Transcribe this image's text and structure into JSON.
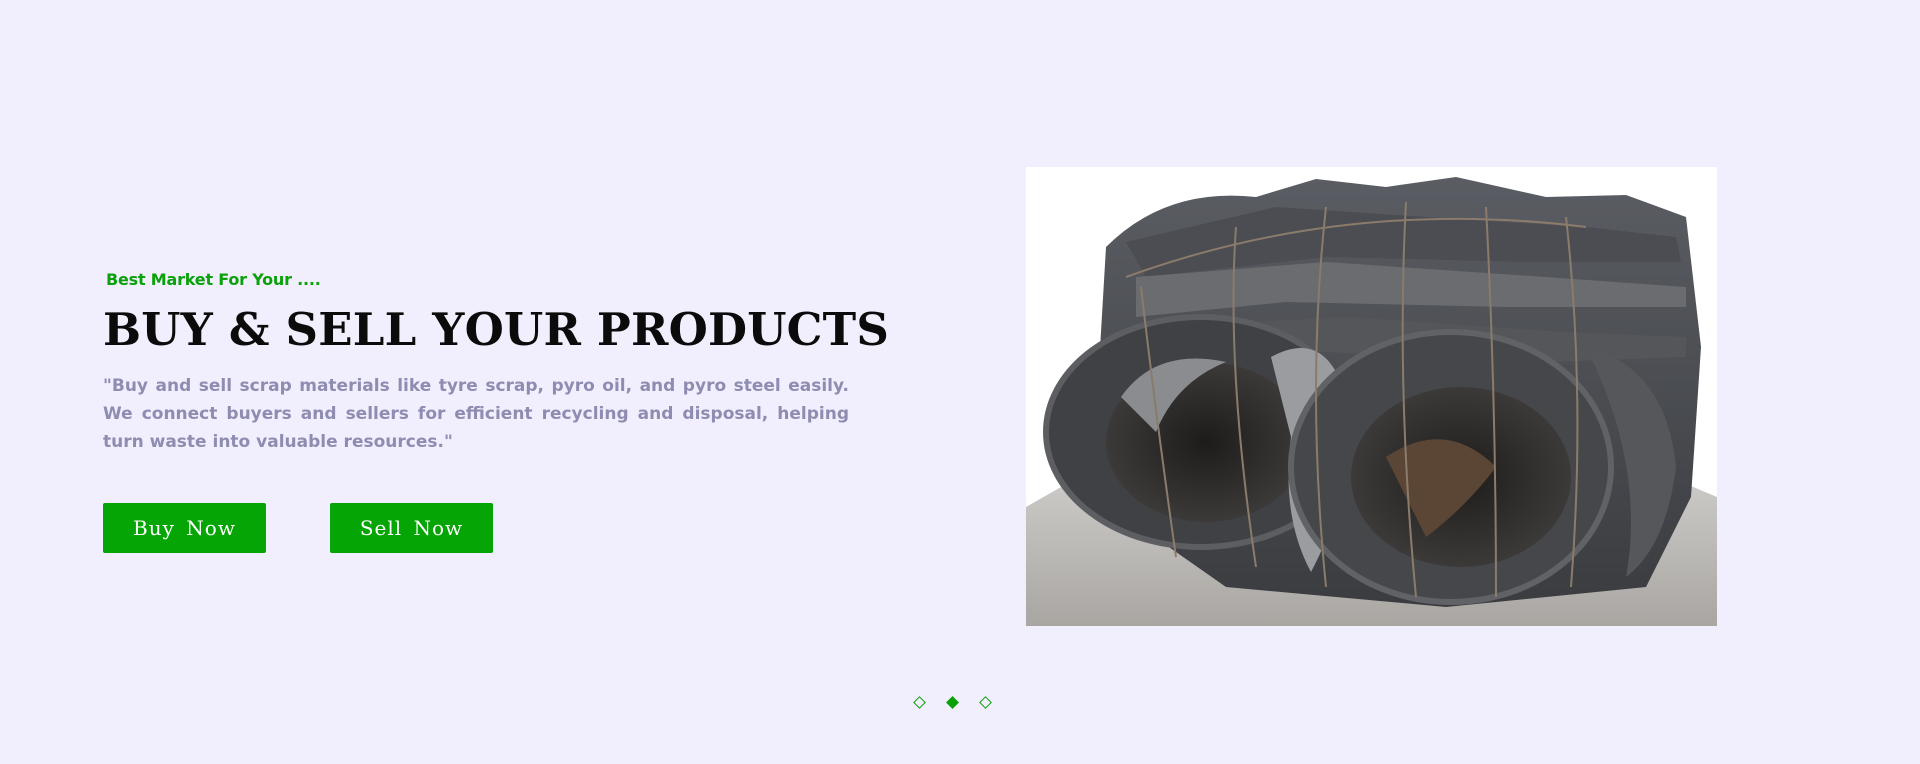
{
  "hero": {
    "tagline": "Best Market For Your ....",
    "headline": "BUY & SELL YOUR PRODUCTS",
    "description": "\"Buy and sell scrap materials like tyre scrap, pyro oil, and pyro steel easily. We connect buyers and sellers for efficient recycling and disposal, helping turn waste into valuable resources.\"",
    "buttons": {
      "buy_label": "Buy  Now",
      "sell_label": "Sell  Now"
    },
    "image": {
      "subject": "baled scrap tyres tied with wire",
      "icon": "tyre-scrap-photo"
    }
  },
  "carousel": {
    "slide_count": 3,
    "active_index": 2
  },
  "colors": {
    "background": "#f1effd",
    "accent_green": "#05a505",
    "headline": "#0b0b0b",
    "description": "#8e8cb0"
  }
}
